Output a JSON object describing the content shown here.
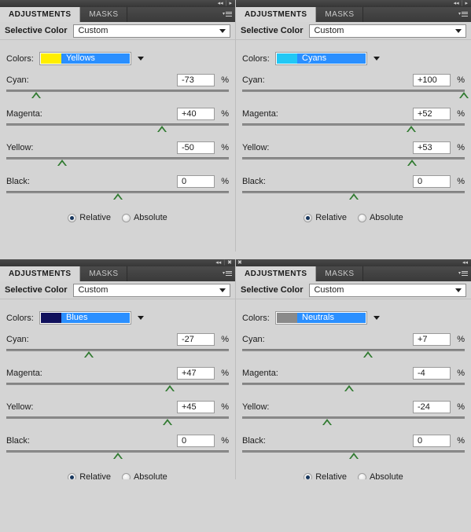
{
  "app": {
    "background_color": "#d4d4d4",
    "accent_select_color": "#2a8fff",
    "slider_thumb_color": "#2f7a2f"
  },
  "panels": [
    {
      "id": "panel-top-left",
      "titlebar": {
        "icons": [
          "◂◂",
          "▸"
        ],
        "left_grip": ""
      },
      "tabs": [
        {
          "label": "ADJUSTMENTS",
          "active": true
        },
        {
          "label": "MASKS",
          "active": false
        }
      ],
      "header": {
        "title": "Selective Color",
        "preset_value": "Custom"
      },
      "colors": {
        "label": "Colors:",
        "value": "Yellows",
        "swatch_color": "#ffee00"
      },
      "sliders": [
        {
          "label": "Cyan:",
          "value": "-73",
          "unit": "%",
          "percent": 13.5
        },
        {
          "label": "Magenta:",
          "value": "+40",
          "unit": "%",
          "percent": 70.0
        },
        {
          "label": "Yellow:",
          "value": "-50",
          "unit": "%",
          "percent": 25.0
        },
        {
          "label": "Black:",
          "value": "0",
          "unit": "%",
          "percent": 50.0
        }
      ],
      "mode": {
        "relative_label": "Relative",
        "absolute_label": "Absolute",
        "selected": "Relative"
      }
    },
    {
      "id": "panel-top-right",
      "titlebar": {
        "icons": [
          "◂◂",
          "▸"
        ],
        "left_grip": ""
      },
      "tabs": [
        {
          "label": "ADJUSTMENTS",
          "active": true
        },
        {
          "label": "MASKS",
          "active": false
        }
      ],
      "header": {
        "title": "Selective Color",
        "preset_value": "Custom"
      },
      "colors": {
        "label": "Colors:",
        "value": "Cyans",
        "swatch_color": "#22c8f5"
      },
      "sliders": [
        {
          "label": "Cyan:",
          "value": "+100",
          "unit": "%",
          "percent": 99.5
        },
        {
          "label": "Magenta:",
          "value": "+52",
          "unit": "%",
          "percent": 76.0
        },
        {
          "label": "Yellow:",
          "value": "+53",
          "unit": "%",
          "percent": 76.5
        },
        {
          "label": "Black:",
          "value": "0",
          "unit": "%",
          "percent": 50.0
        }
      ],
      "mode": {
        "relative_label": "Relative",
        "absolute_label": "Absolute",
        "selected": "Relative"
      }
    },
    {
      "id": "panel-bottom-left",
      "titlebar": {
        "icons": [
          "◂◂",
          "✖"
        ],
        "left_grip": ""
      },
      "tabs": [
        {
          "label": "ADJUSTMENTS",
          "active": true
        },
        {
          "label": "MASKS",
          "active": false
        }
      ],
      "header": {
        "title": "Selective Color",
        "preset_value": "Custom"
      },
      "colors": {
        "label": "Colors:",
        "value": "Blues",
        "swatch_color": "#10105c"
      },
      "sliders": [
        {
          "label": "Cyan:",
          "value": "-27",
          "unit": "%",
          "percent": 37.0
        },
        {
          "label": "Magenta:",
          "value": "+47",
          "unit": "%",
          "percent": 73.5
        },
        {
          "label": "Yellow:",
          "value": "+45",
          "unit": "%",
          "percent": 72.5
        },
        {
          "label": "Black:",
          "value": "0",
          "unit": "%",
          "percent": 50.0
        }
      ],
      "mode": {
        "relative_label": "Relative",
        "absolute_label": "Absolute",
        "selected": "Relative"
      }
    },
    {
      "id": "panel-bottom-right",
      "titlebar": {
        "icons": [
          "◂◂"
        ],
        "left_grip": "✖"
      },
      "tabs": [
        {
          "label": "ADJUSTMENTS",
          "active": true
        },
        {
          "label": "MASKS",
          "active": false
        }
      ],
      "header": {
        "title": "Selective Color",
        "preset_value": "Custom"
      },
      "colors": {
        "label": "Colors:",
        "value": "Neutrals",
        "swatch_color": "#8a8a8a"
      },
      "sliders": [
        {
          "label": "Cyan:",
          "value": "+7",
          "unit": "%",
          "percent": 56.5
        },
        {
          "label": "Magenta:",
          "value": "-4",
          "unit": "%",
          "percent": 48.0
        },
        {
          "label": "Yellow:",
          "value": "-24",
          "unit": "%",
          "percent": 38.0
        },
        {
          "label": "Black:",
          "value": "0",
          "unit": "%",
          "percent": 50.0
        }
      ],
      "mode": {
        "relative_label": "Relative",
        "absolute_label": "Absolute",
        "selected": "Relative"
      }
    }
  ]
}
